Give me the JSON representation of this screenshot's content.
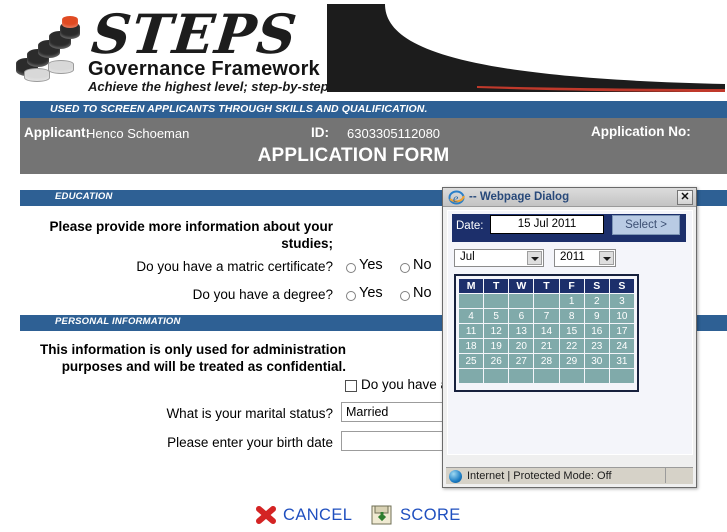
{
  "logo": {
    "wordmark": "STEPS",
    "subtitle": "Governance Framework",
    "tagline": "Achieve the highest level; step-by-step"
  },
  "header": {
    "strap_text": "USED TO SCREEN APPLICANTS THROUGH SKILLS AND QUALIFICATION.",
    "applicant_label": "Applicant:",
    "applicant_value": "Henco Schoeman",
    "id_label": "ID:",
    "id_value": "6303305112080",
    "application_no_label": "Application No:",
    "form_title": "APPLICATION FORM",
    "strap_color": "#2e6094",
    "header_bg": "#747474"
  },
  "education": {
    "section_label": "EDUCATION",
    "help_line1": "Please provide more information about your",
    "help_line2": "studies;",
    "questions": [
      {
        "label": "Do you have a matric certificate?",
        "options": [
          {
            "label": "Yes",
            "selected": false
          },
          {
            "label": "No",
            "selected": false
          }
        ]
      },
      {
        "label": "Do you have a degree?",
        "options": [
          {
            "label": "Yes",
            "selected": false
          },
          {
            "label": "No",
            "selected": false
          }
        ]
      }
    ]
  },
  "personal": {
    "section_label": "PERSONAL INFORMATION",
    "help_line1": "This information is only used for administration",
    "help_line2": "purposes and will be treated as confidential.",
    "checkbox_label": "Do you have a",
    "checkbox_checked": false,
    "marital_label": "What is your marital status?",
    "marital_value": "Married",
    "birthdate_label": "Please enter your birth date",
    "birthdate_value": ""
  },
  "footer": {
    "cancel_label": "CANCEL",
    "score_label": "SCORE",
    "link_color": "#1f4fbf"
  },
  "dialog": {
    "title": "-- Webpage Dialog",
    "close_label": "✕",
    "date_label": "Date:",
    "date_value": "15 Jul 2011",
    "select_button": "Select >",
    "month_value": "Jul",
    "year_value": "2011",
    "weekday_headers": [
      "M",
      "T",
      "W",
      "T",
      "F",
      "S",
      "S"
    ],
    "weeks": [
      [
        "",
        "",
        "",
        "",
        "1",
        "2",
        "3"
      ],
      [
        "4",
        "5",
        "6",
        "7",
        "8",
        "9",
        "10"
      ],
      [
        "11",
        "12",
        "13",
        "14",
        "15",
        "16",
        "17"
      ],
      [
        "18",
        "19",
        "20",
        "21",
        "22",
        "23",
        "24"
      ],
      [
        "25",
        "26",
        "27",
        "28",
        "29",
        "30",
        "31"
      ],
      [
        "",
        "",
        "",
        "",
        "",
        "",
        ""
      ]
    ],
    "status_text": "Internet | Protected Mode: Off",
    "header_color": "#1c2f6b",
    "day_cell_color": "#80aaaa"
  }
}
